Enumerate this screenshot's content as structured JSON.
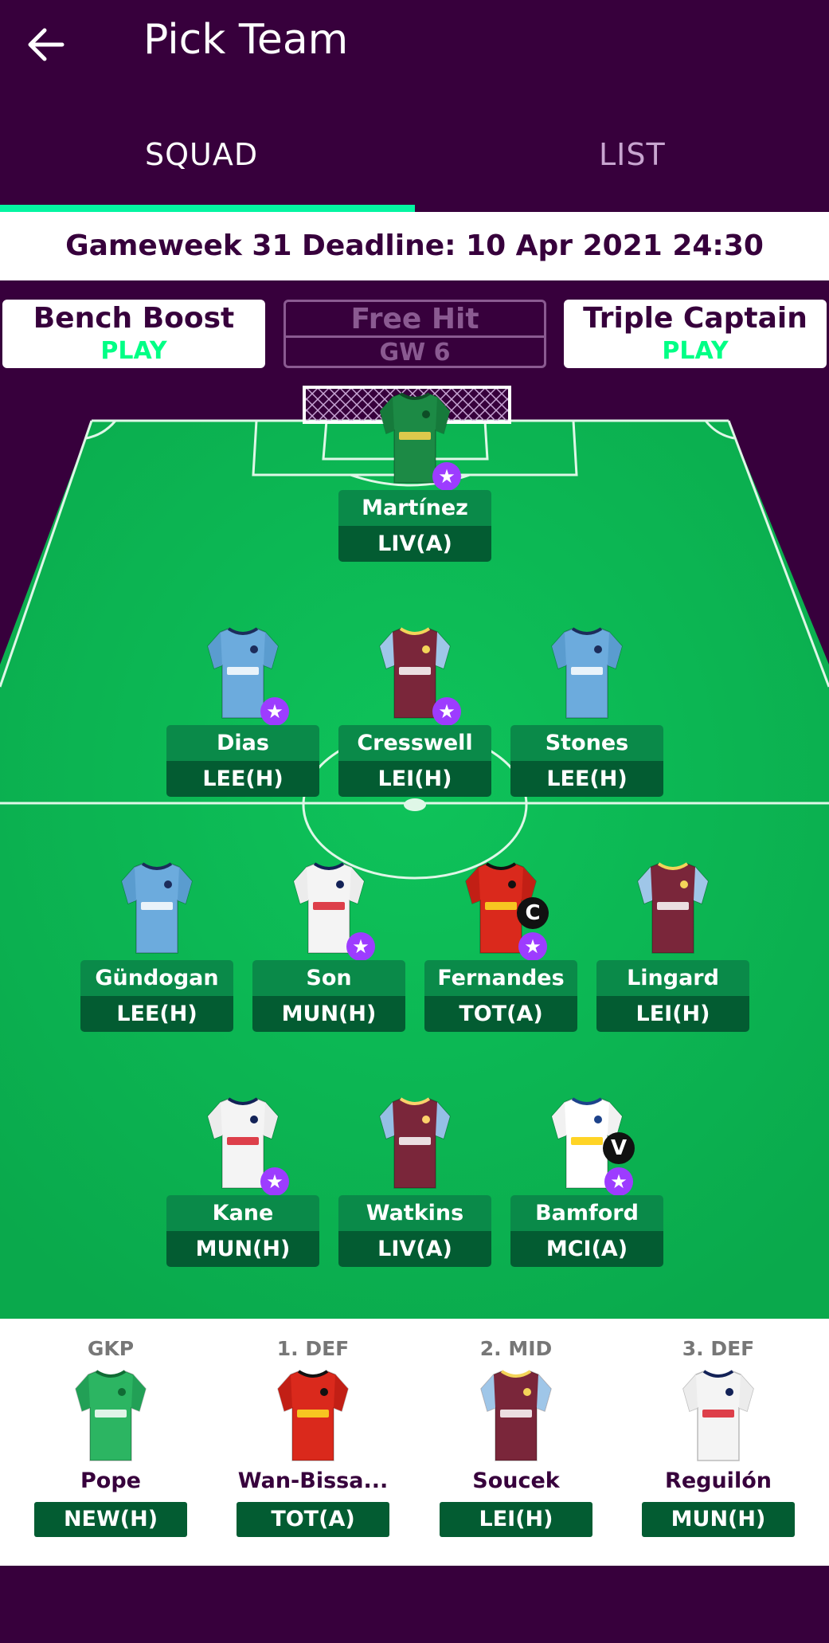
{
  "header": {
    "title": "Pick Team"
  },
  "tabs": {
    "squad": "SQUAD",
    "list": "LIST"
  },
  "deadline": "Gameweek 31 Deadline: 10 Apr 2021 24:30",
  "chips": [
    {
      "name": "Bench Boost",
      "status": "PLAY"
    },
    {
      "name": "Free Hit",
      "status": "GW 6"
    },
    {
      "name": "Triple Captain",
      "status": "PLAY"
    }
  ],
  "starters": [
    {
      "name": "Martínez",
      "fixture": "LIV(A)",
      "kit": "gk-villa"
    },
    {
      "name": "Dias",
      "fixture": "LEE(H)",
      "kit": "city"
    },
    {
      "name": "Cresswell",
      "fixture": "LEI(H)",
      "kit": "westham"
    },
    {
      "name": "Stones",
      "fixture": "LEE(H)",
      "kit": "city"
    },
    {
      "name": "Gündogan",
      "fixture": "LEE(H)",
      "kit": "city"
    },
    {
      "name": "Son",
      "fixture": "MUN(H)",
      "kit": "spurs"
    },
    {
      "name": "Fernandes",
      "fixture": "TOT(A)",
      "kit": "united",
      "badge": "C"
    },
    {
      "name": "Lingard",
      "fixture": "LEI(H)",
      "kit": "westham"
    },
    {
      "name": "Kane",
      "fixture": "MUN(H)",
      "kit": "spurs"
    },
    {
      "name": "Watkins",
      "fixture": "LIV(A)",
      "kit": "villa"
    },
    {
      "name": "Bamford",
      "fixture": "MCI(A)",
      "kit": "leeds",
      "badge": "V"
    }
  ],
  "bench": [
    {
      "pos": "GKP",
      "name": "Pope",
      "fixture": "NEW(H)",
      "kit": "gk-burnley"
    },
    {
      "pos": "1. DEF",
      "name": "Wan-Bissa...",
      "fixture": "TOT(A)",
      "kit": "united"
    },
    {
      "pos": "2. MID",
      "name": "Soucek",
      "fixture": "LEI(H)",
      "kit": "westham"
    },
    {
      "pos": "3. DEF",
      "name": "Reguilón",
      "fixture": "MUN(H)",
      "kit": "spurs"
    }
  ],
  "colors": {
    "primary": "#37003c",
    "accent_green": "#04f5a2",
    "play_green": "#00ff85",
    "pitch": "#0ec35a",
    "label_dark": "#035c32",
    "label_mid": "#0a8a49",
    "star_purple": "#9d3cff"
  },
  "icons": {
    "back": "arrow-left-icon",
    "star": "star-icon"
  }
}
